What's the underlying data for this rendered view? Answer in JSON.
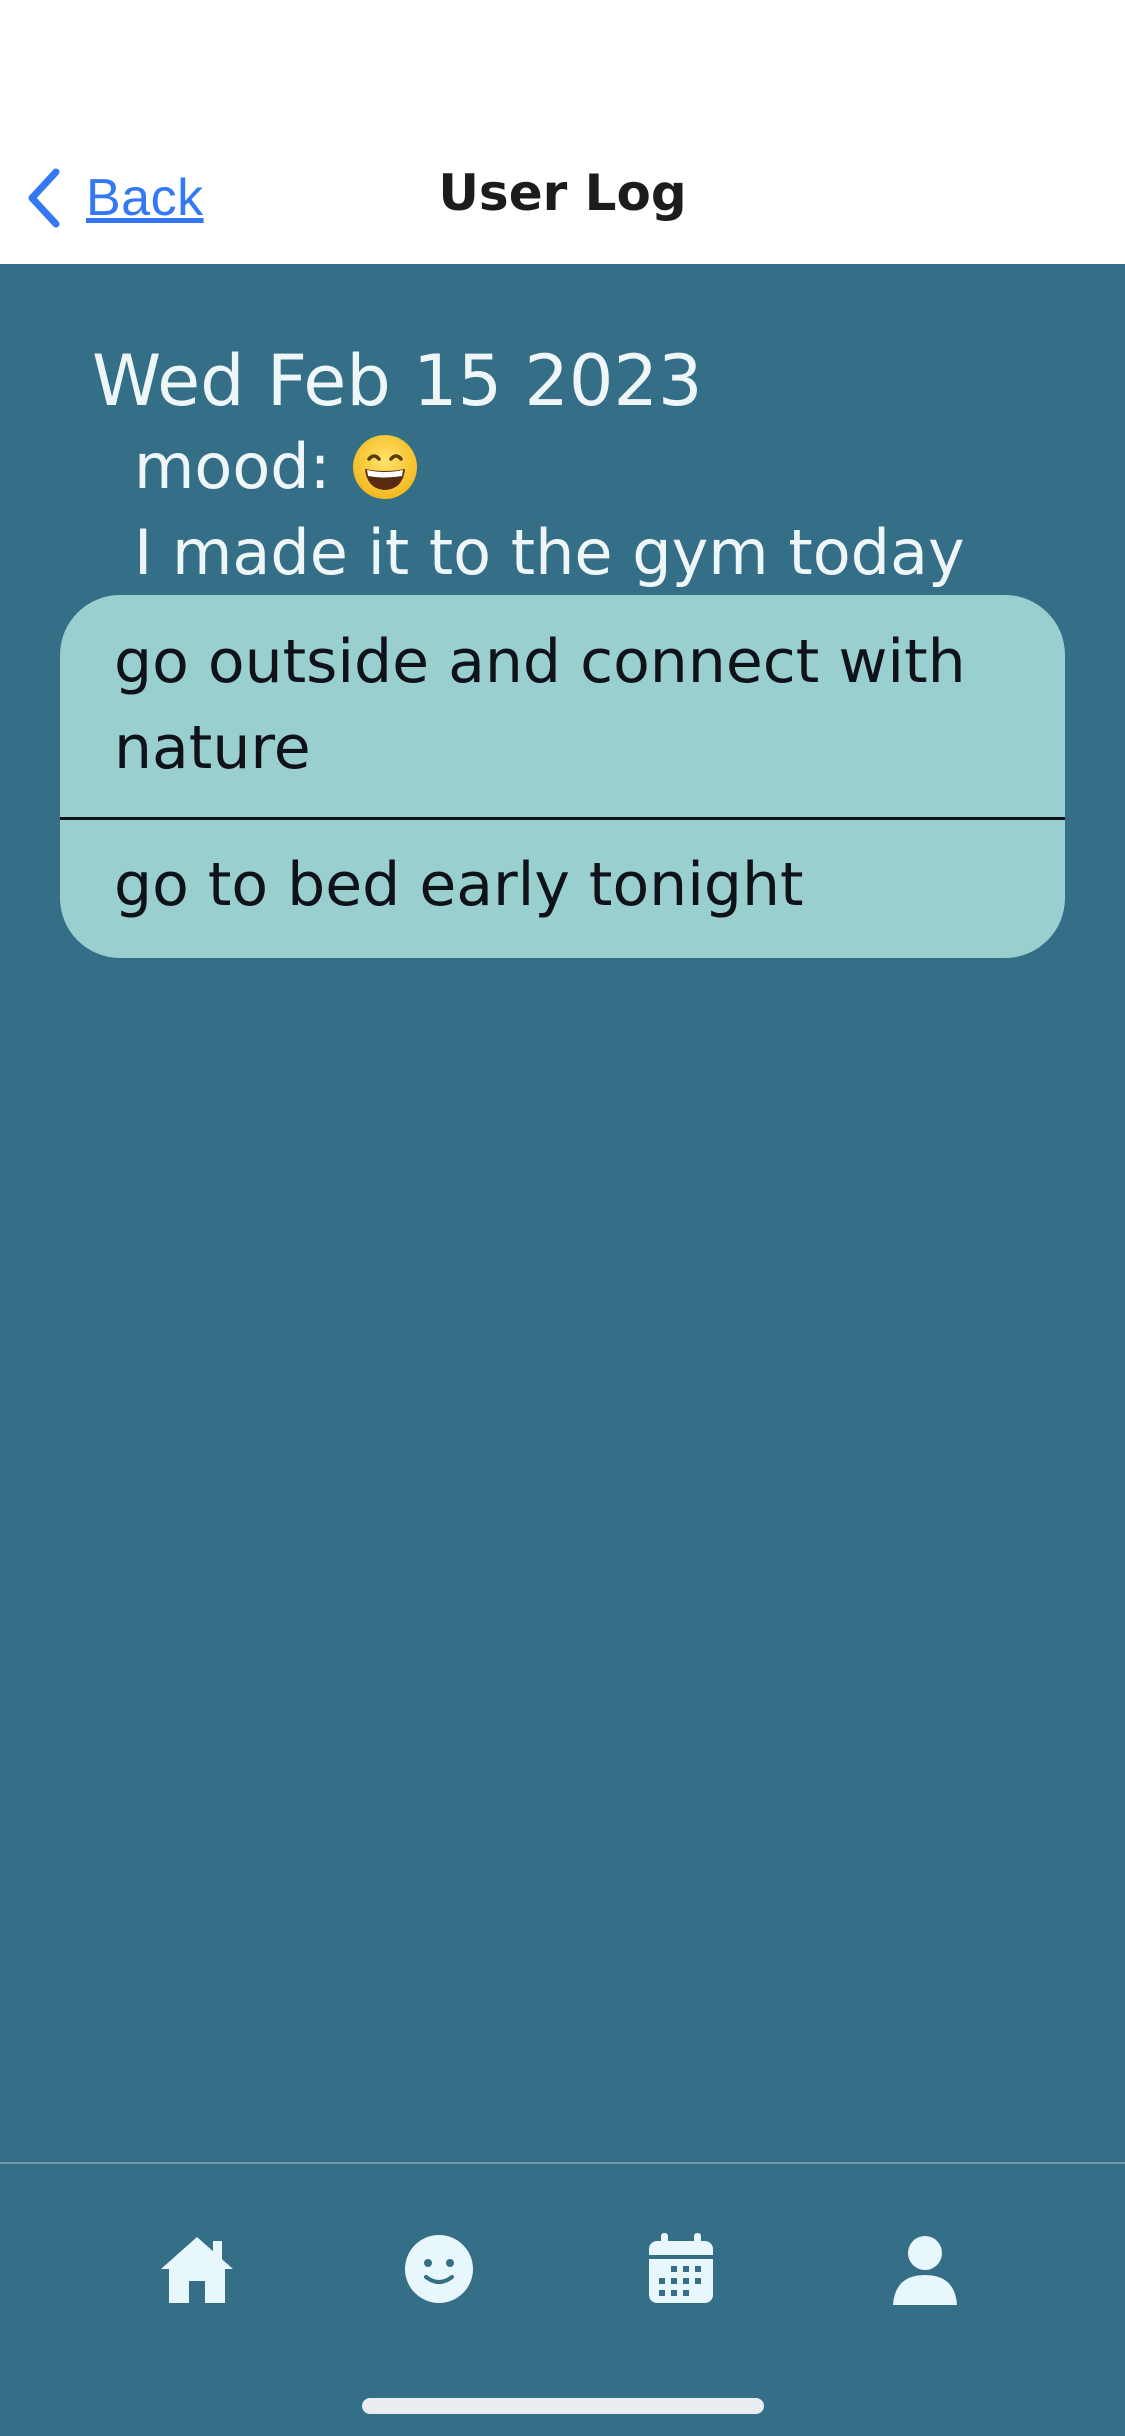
{
  "nav": {
    "back_label": "Back",
    "title": "User Log"
  },
  "entry": {
    "date": "Wed Feb 15 2023",
    "mood_label": "mood:",
    "mood_emoji": "grinning-face-icon",
    "note": "I made it to the gym today"
  },
  "suggestions": [
    {
      "text": "go outside and connect with nature"
    },
    {
      "text": "go to bed early tonight"
    }
  ],
  "tabbar": {
    "items": [
      {
        "icon": "home-icon"
      },
      {
        "icon": "smiley-icon"
      },
      {
        "icon": "calendar-icon"
      },
      {
        "icon": "person-icon"
      }
    ]
  },
  "colors": {
    "background": "#346e87",
    "navbar": "#ffffff",
    "link": "#3478f6",
    "suggestion_bg": "#9acfcf",
    "text_light": "#eef6f8",
    "tab_icon": "#e8f7fb"
  }
}
